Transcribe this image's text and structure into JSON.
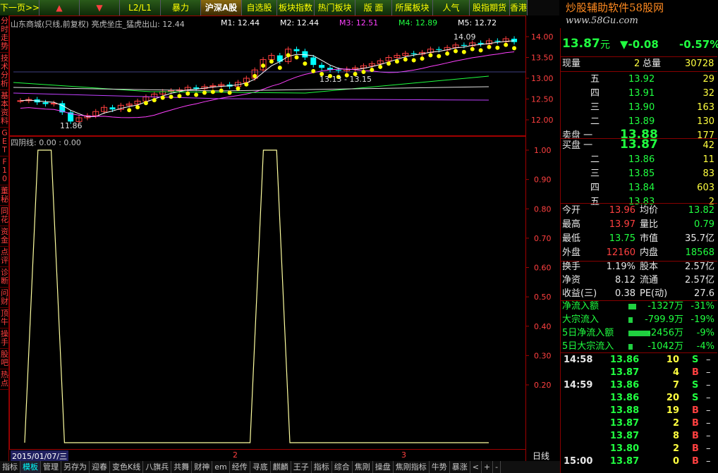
{
  "toolbar": [
    {
      "label": "下一页>>",
      "active": false
    },
    {
      "label": "▲",
      "active": false
    },
    {
      "label": "▼",
      "active": false
    },
    {
      "label": "L2/L1",
      "active": false
    },
    {
      "label": "暴力",
      "active": false
    },
    {
      "label": "沪深A股",
      "active": true
    },
    {
      "label": "自选股",
      "active": false
    },
    {
      "label": "板块指数",
      "active": false
    },
    {
      "label": "热门板块",
      "active": false
    },
    {
      "label": "版 面",
      "active": false
    },
    {
      "label": "所属板块",
      "active": false
    },
    {
      "label": "人气",
      "active": false
    },
    {
      "label": "股指期货",
      "active": false
    },
    {
      "label": "香港",
      "active": false
    }
  ],
  "left_tabs": [
    "分时走势",
    "技术分析",
    "基本资料",
    "GET",
    "F10",
    "董秘",
    "同花",
    "资金",
    "点评",
    "诊断",
    "问财",
    "顶牛",
    "操手",
    "股吧",
    "热点"
  ],
  "watermark": {
    "title": "炒股辅助软件58股网",
    "url": "www.58Gu.com"
  },
  "main_chart": {
    "legend": "山东商城(只线,前复权) 亮虎坐庄_猛虎出山: 12.44",
    "ma_labels": [
      {
        "text": "M1: 12.44",
        "color": "#ffffff"
      },
      {
        "text": "M2: 12.44",
        "color": "#ffffff"
      },
      {
        "text": "M3: 12.51",
        "color": "#ff40ff"
      },
      {
        "text": "M4: 12.89",
        "color": "#20ff40"
      },
      {
        "text": "M5: 12.72",
        "color": "#ffffff"
      }
    ],
    "price_ticks": [
      "14.00",
      "13.50",
      "13.00",
      "12.50",
      "12.00"
    ],
    "annotations": [
      "14.09",
      "13.13 - 13.15",
      "11.86"
    ]
  },
  "indicator": {
    "legend": "四阴线: 0.00 : 0.00",
    "ticks": [
      "1.00",
      "0.90",
      "0.80",
      "0.70",
      "0.60",
      "0.50",
      "0.40",
      "0.30",
      "0.20"
    ]
  },
  "date_axis": {
    "start_label": "2015/01/07/三",
    "month_labels": [
      "2",
      "3"
    ],
    "right_label": "日线"
  },
  "quote": {
    "price": "13.87",
    "unit": "元",
    "change": "▼-0.08",
    "change_pct": "-0.57%",
    "volume_now_label": "现量",
    "volume_now": "2",
    "volume_total_label": "总量",
    "volume_total": "30728",
    "sell_levels": [
      {
        "label": "五",
        "price": "13.92",
        "vol": "29"
      },
      {
        "label": "四",
        "price": "13.91",
        "vol": "32"
      },
      {
        "label": "三",
        "price": "13.90",
        "vol": "163"
      },
      {
        "label": "二",
        "price": "13.89",
        "vol": "130"
      },
      {
        "label": "卖盘 一",
        "price": "13.88",
        "vol": "177"
      }
    ],
    "buy_levels": [
      {
        "label": "买盘 一",
        "price": "13.87",
        "vol": "42"
      },
      {
        "label": "二",
        "price": "13.86",
        "vol": "11"
      },
      {
        "label": "三",
        "price": "13.85",
        "vol": "83"
      },
      {
        "label": "四",
        "price": "13.84",
        "vol": "603"
      },
      {
        "label": "五",
        "price": "13.83",
        "vol": "2"
      }
    ],
    "stats": [
      {
        "l1": "今开",
        "v1": "13.96",
        "c1": "red",
        "l2": "均价",
        "v2": "13.82",
        "c2": "green"
      },
      {
        "l1": "最高",
        "v1": "13.97",
        "c1": "red",
        "l2": "量比",
        "v2": "0.79",
        "c2": "green"
      },
      {
        "l1": "最低",
        "v1": "13.75",
        "c1": "green",
        "l2": "市值",
        "v2": "35.7亿",
        "c2": "white"
      },
      {
        "l1": "外盘",
        "v1": "12160",
        "c1": "red",
        "l2": "内盘",
        "v2": "18568",
        "c2": "green"
      }
    ],
    "stats2": [
      {
        "l1": "换手",
        "v1": "1.19%",
        "l2": "股本",
        "v2": "2.57亿"
      },
      {
        "l1": "净资",
        "v1": "8.12",
        "l2": "流通",
        "v2": "2.57亿"
      },
      {
        "l1": "收益(三)",
        "v1": "0.38",
        "l2": "PE(动)",
        "v2": "27.6"
      }
    ],
    "flows": [
      {
        "label": "净流入额",
        "value": "-1327万",
        "pct": "-31%",
        "bar": 0.31
      },
      {
        "label": "大宗流入",
        "value": "-799.9万",
        "pct": "-19%",
        "bar": 0.19
      },
      {
        "label": "5日净流入额",
        "value": "-2456万",
        "pct": "-9%",
        "bar": 0.9
      },
      {
        "label": "5日大宗流入",
        "value": "-1042万",
        "pct": "-4%",
        "bar": 0.18
      }
    ],
    "ticks": [
      {
        "time": "14:58",
        "price": "13.86",
        "vol": "10",
        "side": "S"
      },
      {
        "time": "",
        "price": "13.87",
        "vol": "4",
        "side": "B"
      },
      {
        "time": "14:59",
        "price": "13.86",
        "vol": "7",
        "side": "S"
      },
      {
        "time": "",
        "price": "13.86",
        "vol": "20",
        "side": "S"
      },
      {
        "time": "",
        "price": "13.88",
        "vol": "19",
        "side": "B"
      },
      {
        "time": "",
        "price": "13.87",
        "vol": "2",
        "side": "B"
      },
      {
        "time": "",
        "price": "13.87",
        "vol": "8",
        "side": "B"
      },
      {
        "time": "",
        "price": "13.80",
        "vol": "2",
        "side": "B"
      },
      {
        "time": "15:00",
        "price": "13.87",
        "vol": "0",
        "side": "B"
      }
    ]
  },
  "bottom_tabs": [
    "指标",
    "模板",
    "管理",
    "另存为",
    "迎春",
    "变色K线",
    "八旗兵",
    "共舞",
    "财神",
    "em",
    "经传",
    "寻底",
    "麒麟",
    "王子",
    "指标",
    "综合",
    "焦刚",
    "操盘",
    "焦刚指标",
    "牛势",
    "暴涨",
    "<",
    "+",
    "-"
  ],
  "chart_data": {
    "type": "line",
    "series": [
      {
        "values": [
          0,
          1,
          1,
          0,
          0,
          0,
          0,
          0,
          0,
          0,
          0,
          0,
          0,
          0,
          0,
          0,
          0,
          0,
          1,
          1,
          0,
          0,
          0,
          0,
          0,
          0,
          0,
          0,
          0,
          0,
          0,
          0,
          0,
          0,
          0,
          0
        ]
      }
    ],
    "ylim": [
      0,
      1
    ],
    "title": "四阴线: 0.00 : 0.00"
  }
}
